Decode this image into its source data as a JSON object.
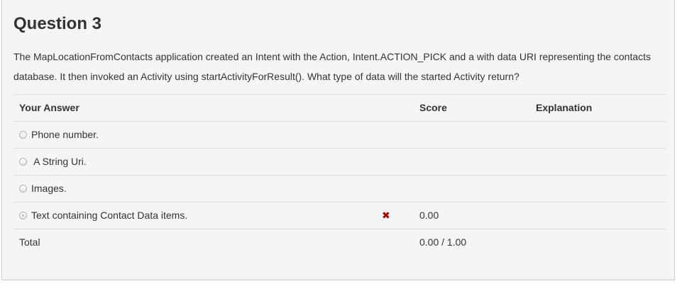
{
  "question": {
    "title": "Question 3",
    "text": "The MapLocationFromContacts application created an Intent with the Action, Intent.ACTION_PICK and a with data URI representing the contacts database. It then invoked an Activity using startActivityForResult(). What type of data will the started Activity return?"
  },
  "table": {
    "headers": {
      "answer": "Your Answer",
      "score": "Score",
      "explanation": "Explanation"
    },
    "options": [
      {
        "label": "Phone number.",
        "selected": false
      },
      {
        "label": " A String Uri.",
        "selected": false
      },
      {
        "label": "Images.",
        "selected": false
      },
      {
        "label": "Text containing Contact Data items.",
        "selected": true,
        "mark": "✖",
        "score": "0.00"
      }
    ],
    "total": {
      "label": "Total",
      "score": "0.00 / 1.00"
    }
  },
  "colors": {
    "incorrect": "#b00000",
    "panel_bg": "#f5f5f5",
    "divider": "#dddddd"
  },
  "icons": {
    "incorrect": "x-mark-icon",
    "radio": "radio-button-icon"
  }
}
